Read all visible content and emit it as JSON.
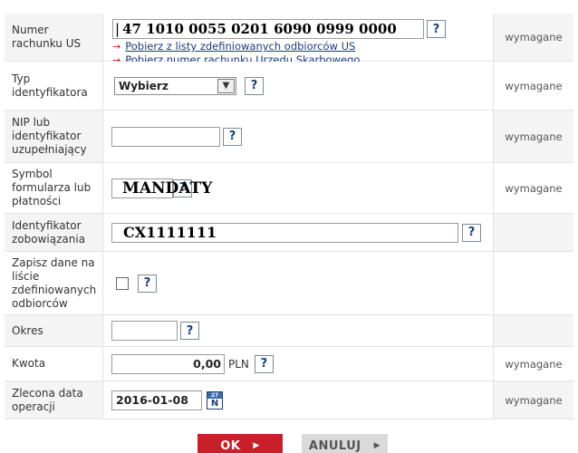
{
  "form": {
    "account": {
      "label": "Numer rachunku US",
      "value": "47 1010 0055 0201 6090 0999 0000",
      "link1": "Pobierz z listy zdefiniowanych odbiorców US",
      "link2": "Pobierz numer rachunku Urzedu Skarbowego",
      "required": "wymagane"
    },
    "id_type": {
      "label": "Typ identyfikatora",
      "selected": "Wybierz",
      "required": "wymagane"
    },
    "nip": {
      "label": "NIP lub identyfikator uzupełniający",
      "value": "",
      "required": "wymagane"
    },
    "form_symbol": {
      "label": "Symbol formularza lub płatności",
      "value": "MANDATY",
      "required": "wymagane"
    },
    "obligation_id": {
      "label": "Identyfikator zobowiązania",
      "value": "CX1111111"
    },
    "save": {
      "label": "Zapisz dane na liście zdefiniowanych odbiorców"
    },
    "period": {
      "label": "Okres",
      "value": ""
    },
    "amount": {
      "label": "Kwota",
      "value": "0,00",
      "currency": "PLN",
      "required": "wymagane"
    },
    "date": {
      "label": "Zlecona data operacji",
      "value": "2016-01-08",
      "cal_top": "27",
      "cal_bottom": "N",
      "required": "wymagane"
    },
    "help": "?"
  },
  "buttons": {
    "ok": "OK",
    "cancel": "ANULUJ"
  },
  "colors": {
    "ok_bg": "#c8202a",
    "cancel_bg": "#dadada",
    "link": "#1a3c7a",
    "help_text": "#1c3f74"
  }
}
